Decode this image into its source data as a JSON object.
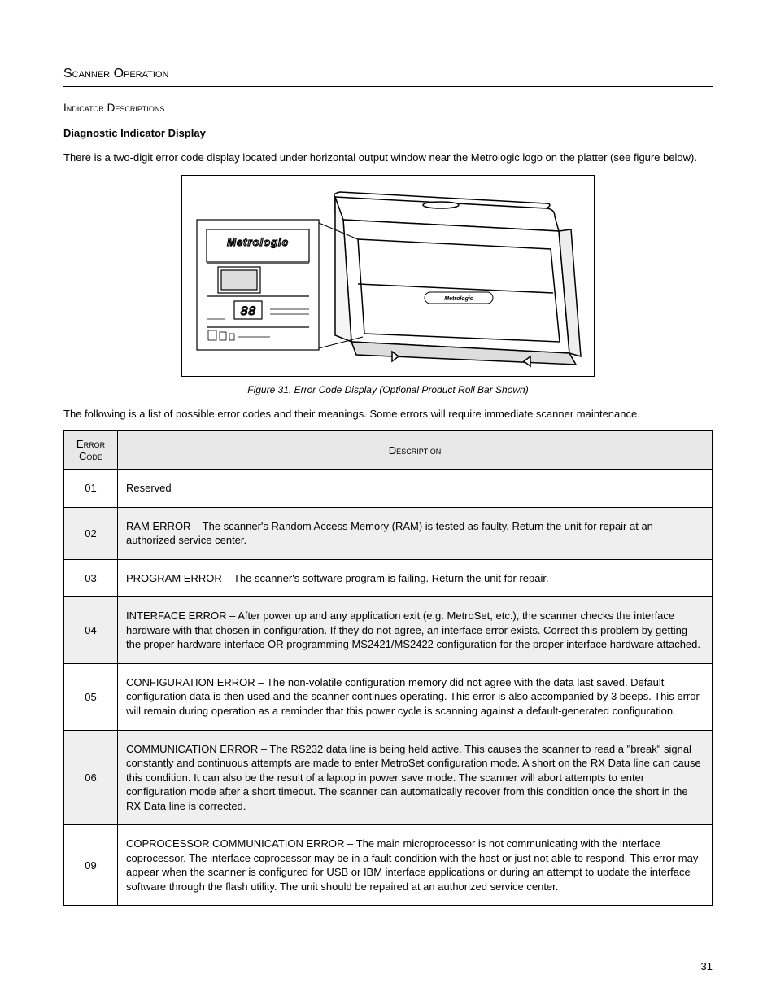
{
  "header": {
    "section_title": "Scanner Operation",
    "subsection_title": "Indicator Descriptions",
    "bold_line": "Diagnostic Indicator Display"
  },
  "intro_para": "There is a two-digit error code display located under horizontal output window near the Metrologic logo on the platter (see figure below).",
  "figure": {
    "caption": "Figure 31.  Error Code Display (Optional Product Roll Bar Shown)",
    "label_small": "Metrologic",
    "label_logo": "Metrologic",
    "digits": "88"
  },
  "post_figure_para": "The following is a list of possible error codes and their meanings.  Some errors will require immediate scanner maintenance.",
  "table": {
    "col_code": "Error Code",
    "col_desc": "Description",
    "rows": [
      {
        "code": "01",
        "desc": "Reserved",
        "shaded": false
      },
      {
        "code": "02",
        "desc": "RAM ERROR – The scanner's Random Access Memory (RAM) is tested as faulty.  Return the unit for repair at an authorized service center.",
        "shaded": true
      },
      {
        "code": "03",
        "desc": "PROGRAM ERROR – The scanner's software program is failing.  Return the unit for repair.",
        "shaded": false
      },
      {
        "code": "04",
        "desc": "INTERFACE ERROR – After power up and any application exit (e.g. MetroSet, etc.), the scanner checks the interface hardware with that chosen in configuration.  If they do not agree, an interface error exists.  Correct this problem by getting the proper hardware interface OR programming MS2421/MS2422 configuration for the proper interface hardware attached.",
        "shaded": true
      },
      {
        "code": "05",
        "desc": "CONFIGURATION ERROR – The non-volatile configuration memory did not agree with the data last saved.  Default configuration data is then used and the scanner continues operating.  This error is also accompanied by 3 beeps.  This error will remain during operation as a reminder that this power cycle is scanning against a default-generated configuration.",
        "shaded": false
      },
      {
        "code": "06",
        "desc": "COMMUNICATION ERROR – The RS232 data line is being held active.  This causes the scanner to read a \"break\" signal constantly and continuous attempts are made to enter MetroSet configuration mode.  A short on the RX Data line can cause this condition.  It can also be the result of a laptop in power save mode.  The scanner will abort attempts to enter configuration mode after a short timeout.  The scanner can automatically recover from this condition once the short in the RX Data line is corrected.",
        "shaded": true
      },
      {
        "code": "09",
        "desc": "COPROCESSOR COMMUNICATION ERROR – The main microprocessor is not communicating with the interface coprocessor.  The interface coprocessor may be in a fault condition with the host or just not able to respond.  This error may appear when the scanner is configured for USB or IBM interface applications or during an attempt to update the interface software through the flash utility.  The unit should be repaired at an authorized service center.",
        "shaded": false
      }
    ]
  },
  "page_number": "31"
}
